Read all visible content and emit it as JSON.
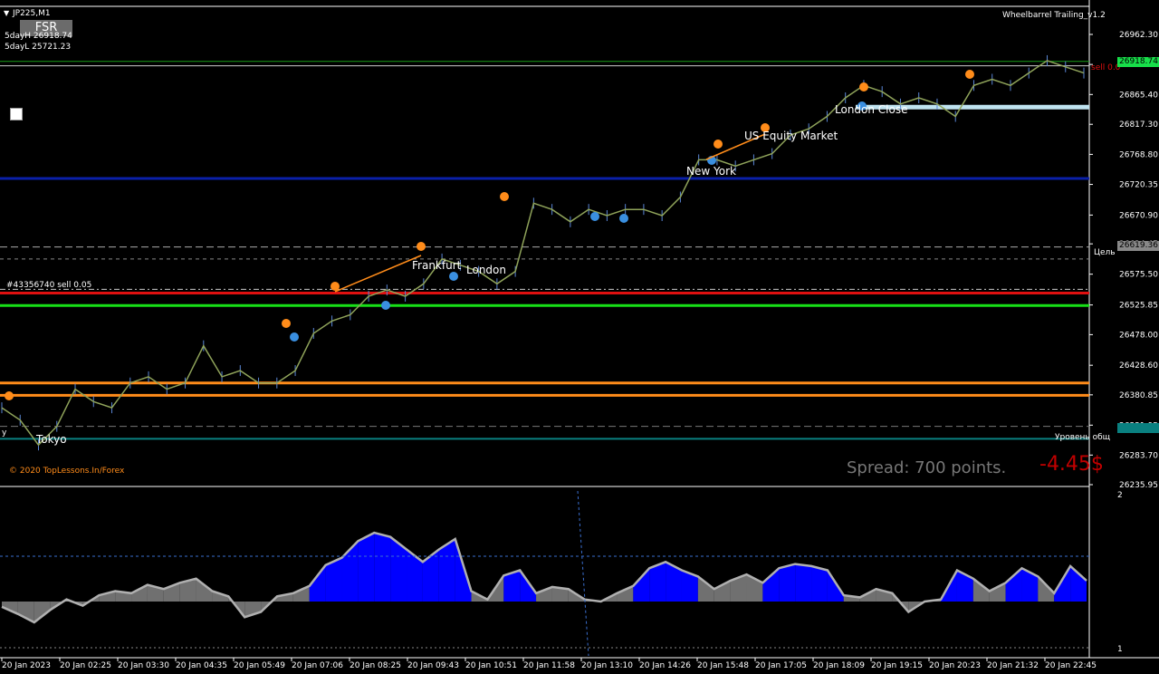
{
  "header": {
    "symbol": "JP225,M1",
    "fsr_button": "FSR",
    "day_high": "5dayH 26918.74",
    "day_low": "5dayL 25721.23",
    "indicator_name": "Wheelbarrel Trailing_v1.2",
    "order_label": "#43356740 sell 0.05",
    "copyright": "© 2020 TopLessons.In/Forex",
    "spread": "Spread: 700 points.",
    "profit": "-4.45$",
    "target_label": "Цель",
    "total_level_label": "Уровень общ",
    "y_label": "y",
    "sell_tag": "sell 0.0"
  },
  "sessions": [
    "Tokyo",
    "Frankfurt",
    "London",
    "New York",
    "US Equity Market",
    "London Close"
  ],
  "colors": {
    "background": "#000000",
    "price_line": "#8fa35a",
    "support_blue": "#0a1fa8",
    "sell_red": "#e01010",
    "green_level": "#17e017",
    "orange_level": "#ff8c1a",
    "osc_fill": "#0000ff",
    "osc_gray": "#707070",
    "current_price_bg": "#17e04a"
  },
  "price_tags": {
    "current": "26918.74",
    "target": "26619.36",
    "bottom": "26310.35"
  },
  "chart_data": {
    "type": "line",
    "title": "JP225,M1",
    "xlabel": "",
    "ylabel": "",
    "ylim": [
      26235.95,
      26962.3
    ],
    "y_ticks": [
      "26962.30",
      "26913.85",
      "26865.40",
      "26817.30",
      "26768.80",
      "26720.35",
      "26670.90",
      "26624.45",
      "26575.50",
      "26525.85",
      "26478.00",
      "26428.60",
      "26380.85",
      "26331.95",
      "26283.70",
      "26235.95"
    ],
    "x_ticks": [
      "20 Jan 2023",
      "20 Jan 02:25",
      "20 Jan 03:30",
      "20 Jan 04:35",
      "20 Jan 05:49",
      "20 Jan 07:06",
      "20 Jan 08:25",
      "20 Jan 09:43",
      "20 Jan 10:51",
      "20 Jan 11:58",
      "20 Jan 13:10",
      "20 Jan 14:26",
      "20 Jan 15:48",
      "20 Jan 17:05",
      "20 Jan 18:09",
      "20 Jan 19:15",
      "20 Jan 20:23",
      "20 Jan 21:32",
      "20 Jan 22:45"
    ],
    "price_series": [
      26360,
      26340,
      26300,
      26330,
      26390,
      26370,
      26360,
      26400,
      26410,
      26390,
      26400,
      26460,
      26410,
      26420,
      26400,
      26400,
      26420,
      26480,
      26500,
      26510,
      26540,
      26550,
      26540,
      26560,
      26600,
      26590,
      26580,
      26560,
      26580,
      26690,
      26680,
      26660,
      26680,
      26670,
      26680,
      26680,
      26670,
      26700,
      26760,
      26760,
      26750,
      26760,
      26770,
      26800,
      26810,
      26830,
      26860,
      26880,
      26870,
      26850,
      26860,
      26850,
      26830,
      26880,
      26890,
      26880,
      26900,
      26920,
      26910,
      26900
    ],
    "levels": [
      {
        "name": "5dayH",
        "value": 26918.74
      },
      {
        "name": "Цель",
        "value": 26619.36
      },
      {
        "name": "sell",
        "value": 26545
      },
      {
        "name": "green",
        "value": 26525
      },
      {
        "name": "blue",
        "value": 26730
      },
      {
        "name": "orange1",
        "value": 26400
      },
      {
        "name": "orange2",
        "value": 26380
      }
    ],
    "oscillator": {
      "ylim": [
        1,
        2
      ],
      "y_ticks": [
        "2",
        "1"
      ],
      "values": [
        -0.05,
        -0.12,
        -0.2,
        -0.08,
        0.02,
        -0.04,
        0.06,
        0.1,
        0.08,
        0.16,
        0.12,
        0.18,
        0.22,
        0.1,
        0.05,
        -0.15,
        -0.1,
        0.05,
        0.08,
        0.15,
        0.35,
        0.42,
        0.58,
        0.66,
        0.62,
        0.5,
        0.38,
        0.5,
        0.6,
        0.1,
        0.02,
        0.25,
        0.3,
        0.08,
        0.14,
        0.12,
        0.02,
        0.0,
        0.08,
        0.15,
        0.32,
        0.38,
        0.3,
        0.24,
        0.12,
        0.2,
        0.26,
        0.18,
        0.32,
        0.36,
        0.34,
        0.3,
        0.06,
        0.04,
        0.12,
        0.08,
        -0.1,
        0.0,
        0.02,
        0.3,
        0.22,
        0.1,
        0.18,
        0.32,
        0.24,
        0.08,
        0.34,
        0.2
      ],
      "signal_level": 1.5
    }
  }
}
